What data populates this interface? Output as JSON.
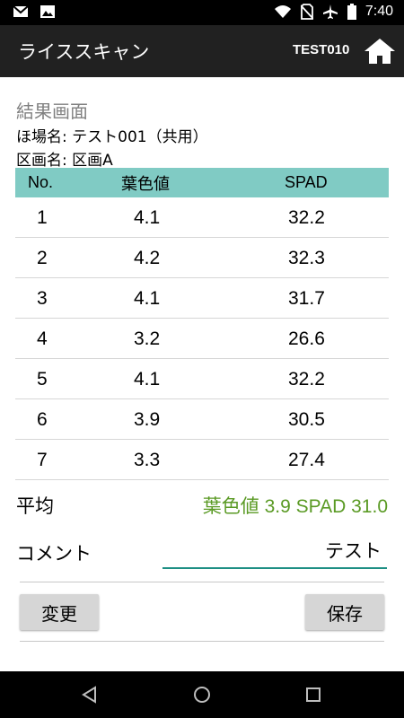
{
  "statusbar": {
    "time": "7:40",
    "icons_left": [
      "mail-icon",
      "image-icon"
    ],
    "icons_right": [
      "wifi-icon",
      "no-sim-icon",
      "airplane-icon",
      "battery-icon"
    ]
  },
  "appbar": {
    "title": "ライススキャン",
    "user": "TEST010",
    "home_icon": "home-icon"
  },
  "screen": {
    "title": "結果画面",
    "field_label": "ほ場名: テスト001（共用）",
    "section_label": "区画名: 区画A"
  },
  "table": {
    "headers": [
      "No.",
      "葉色値",
      "SPAD"
    ],
    "rows": [
      [
        "1",
        "4.1",
        "32.2"
      ],
      [
        "2",
        "4.2",
        "32.3"
      ],
      [
        "3",
        "4.1",
        "31.7"
      ],
      [
        "4",
        "3.2",
        "26.6"
      ],
      [
        "5",
        "4.1",
        "32.2"
      ],
      [
        "6",
        "3.9",
        "30.5"
      ],
      [
        "7",
        "3.3",
        "27.4"
      ]
    ]
  },
  "average": {
    "label": "平均",
    "value": "葉色値 3.9  SPAD 31.0"
  },
  "comment": {
    "label": "コメント",
    "value": "テスト"
  },
  "buttons": {
    "change": "変更",
    "save": "保存"
  },
  "colors": {
    "header_bg": "#80cbc4",
    "average_text": "#5a9a24",
    "appbar_bg": "#212121",
    "input_underline": "#1e8f84"
  },
  "navbar": {
    "icons": [
      "back-icon",
      "home-circle-icon",
      "recents-icon"
    ]
  }
}
